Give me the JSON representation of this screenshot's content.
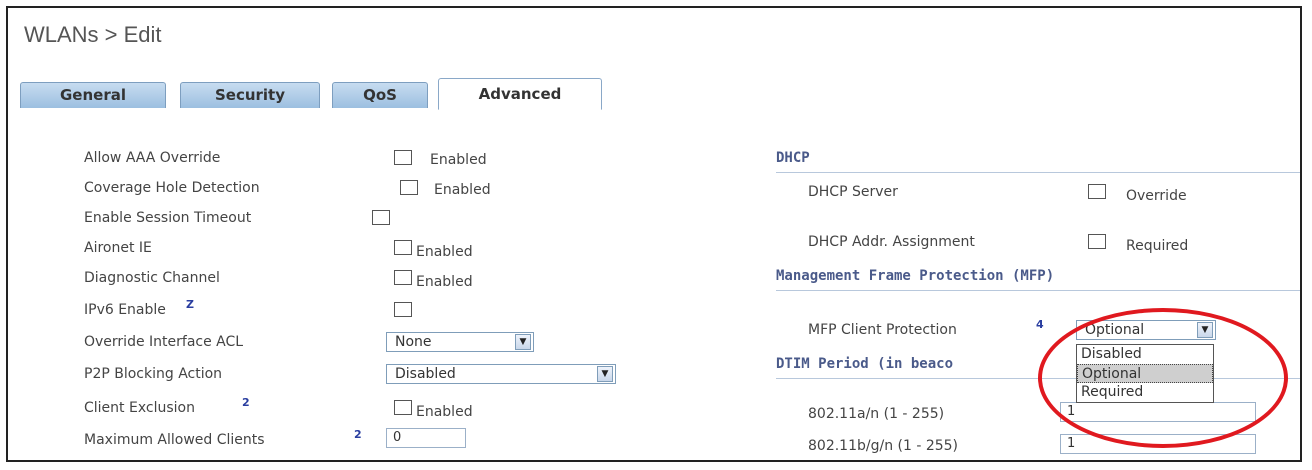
{
  "header": {
    "title": "WLANs > Edit"
  },
  "tabs": [
    {
      "label": "General"
    },
    {
      "label": "Security"
    },
    {
      "label": "QoS"
    },
    {
      "label": "Advanced"
    }
  ],
  "left": {
    "allow_aaa": {
      "label": "Allow AAA Override",
      "text": "Enabled"
    },
    "coverage_hole": {
      "label": "Coverage Hole Detection",
      "text": "Enabled"
    },
    "session_timeout": {
      "label": "Enable Session Timeout"
    },
    "aironet_ie": {
      "label": "Aironet IE",
      "text": "Enabled"
    },
    "diag_channel": {
      "label": "Diagnostic Channel",
      "text": "Enabled"
    },
    "ipv6": {
      "label": "IPv6 Enable",
      "help": "Z"
    },
    "override_acl": {
      "label": "Override Interface ACL",
      "value": "None"
    },
    "p2p": {
      "label": "P2P Blocking Action",
      "value": "Disabled"
    },
    "client_exclusion": {
      "label": "Client Exclusion",
      "help": "2",
      "text": "Enabled"
    },
    "max_clients": {
      "label": "Maximum Allowed Clients",
      "help": "2",
      "value": "0"
    }
  },
  "right": {
    "dhcp_section": "DHCP",
    "dhcp_server": {
      "label": "DHCP Server",
      "text": "Override"
    },
    "dhcp_addr": {
      "label": "DHCP Addr. Assignment",
      "text": "Required"
    },
    "mfp_section": "Management Frame Protection (MFP)",
    "mfp_client": {
      "label": "MFP Client Protection",
      "help": "4",
      "value": "Optional"
    },
    "mfp_options": [
      "Disabled",
      "Optional",
      "Required"
    ],
    "dtim_section": "DTIM Period (in beaco",
    "dtim_section_tail": "in",
    "dtim_a": {
      "label": "802.11a/n (1 - 255)",
      "value": "1"
    },
    "dtim_b": {
      "label": "802.11b/g/n (1 - 255)",
      "value": "1"
    }
  },
  "annotation_color": "#e0191f",
  "accent": "#9cbfe0"
}
